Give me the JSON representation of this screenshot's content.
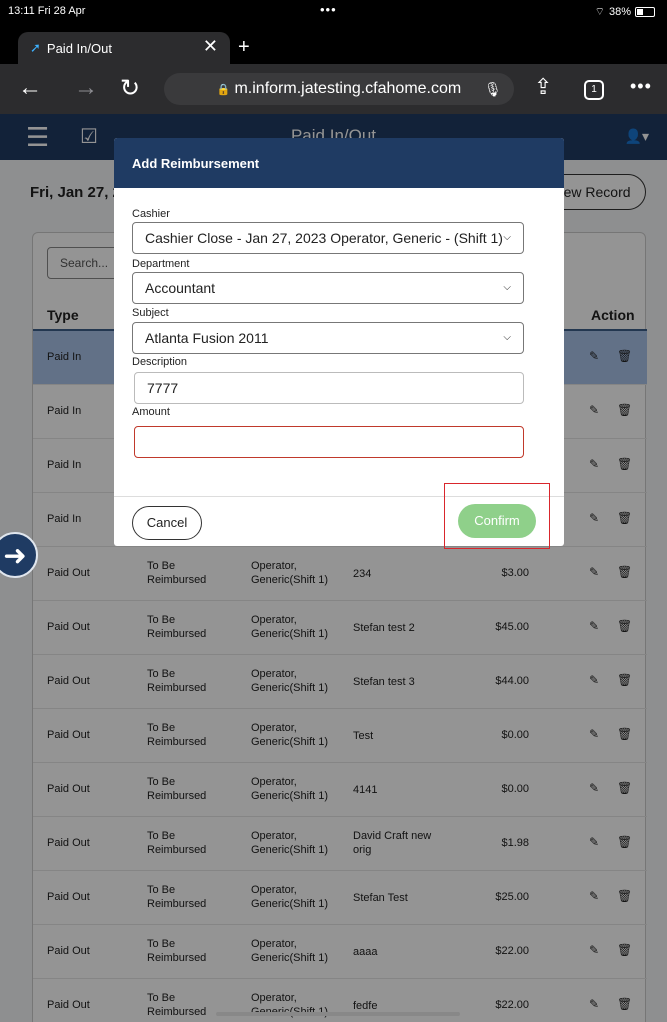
{
  "status": {
    "time": "13:11  Fri 28 Apr",
    "dots": "•••",
    "battery": "38%"
  },
  "browser": {
    "tab_title": "Paid In/Out",
    "url": "m.inform.jatesting.cfahome.com",
    "tab_count": "1"
  },
  "app": {
    "title": "Paid In/Out",
    "date": "Fri, Jan 27, 2",
    "new_record": "New Record",
    "search_placeholder": "Search...",
    "col_type": "Type",
    "col_action": "Action"
  },
  "rows": [
    {
      "type": "Paid In",
      "reimb": "",
      "op": "",
      "desc": "",
      "amount": ""
    },
    {
      "type": "Paid In",
      "reimb": "",
      "op": "",
      "desc": "",
      "amount": ""
    },
    {
      "type": "Paid In",
      "reimb": "",
      "op": "",
      "desc": "",
      "amount": ""
    },
    {
      "type": "Paid In",
      "reimb": "",
      "op": "",
      "desc": "",
      "amount": ""
    },
    {
      "type": "Paid Out",
      "reimb": "To Be Reimbursed",
      "op": "Operator, Generic(Shift 1)",
      "desc": "234",
      "amount": "$3.00"
    },
    {
      "type": "Paid Out",
      "reimb": "To Be Reimbursed",
      "op": "Operator, Generic(Shift 1)",
      "desc": "Stefan test 2",
      "amount": "$45.00"
    },
    {
      "type": "Paid Out",
      "reimb": "To Be Reimbursed",
      "op": "Operator, Generic(Shift 1)",
      "desc": "Stefan test 3",
      "amount": "$44.00"
    },
    {
      "type": "Paid Out",
      "reimb": "To Be Reimbursed",
      "op": "Operator, Generic(Shift 1)",
      "desc": "Test",
      "amount": "$0.00"
    },
    {
      "type": "Paid Out",
      "reimb": "To Be Reimbursed",
      "op": "Operator, Generic(Shift 1)",
      "desc": "4141",
      "amount": "$0.00"
    },
    {
      "type": "Paid Out",
      "reimb": "To Be Reimbursed",
      "op": "Operator, Generic(Shift 1)",
      "desc": "David Craft new orig",
      "amount": "$1.98"
    },
    {
      "type": "Paid Out",
      "reimb": "To Be Reimbursed",
      "op": "Operator, Generic(Shift 1)",
      "desc": "Stefan Test",
      "amount": "$25.00"
    },
    {
      "type": "Paid Out",
      "reimb": "To Be Reimbursed",
      "op": "Operator, Generic(Shift 1)",
      "desc": "aaaa",
      "amount": "$22.00"
    },
    {
      "type": "Paid Out",
      "reimb": "To Be Reimbursed",
      "op": "Operator, Generic(Shift 1)",
      "desc": "fedfe",
      "amount": "$22.00"
    }
  ],
  "modal": {
    "title": "Add Reimbursement",
    "cashier_label": "Cashier",
    "cashier_value": "Cashier Close - Jan 27, 2023 Operator, Generic - (Shift 1)",
    "department_label": "Department",
    "department_value": "Accountant",
    "subject_label": "Subject",
    "subject_value": "Atlanta Fusion 2011",
    "description_label": "Description",
    "description_value": "7777",
    "amount_label": "Amount",
    "amount_value": "",
    "cancel": "Cancel",
    "confirm": "Confirm"
  }
}
